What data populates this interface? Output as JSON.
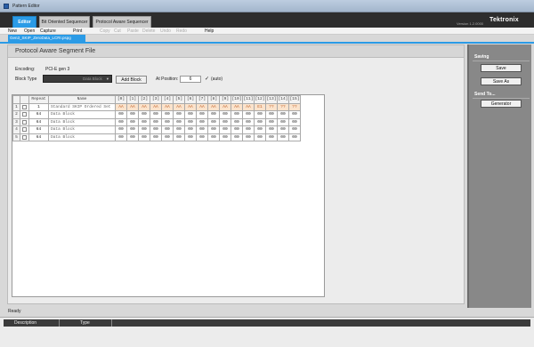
{
  "window": {
    "title": "Pattern Editor"
  },
  "tabs": [
    {
      "label": "Editor",
      "active": true
    },
    {
      "label": "Bit Oriented Sequencer",
      "active": false
    },
    {
      "label": "Protocol Aware Sequencer",
      "active": false
    }
  ],
  "version": "Version 1.2.0000",
  "logo": "Tektronix",
  "menus": {
    "file": [
      "New",
      "Open",
      "Capture",
      "Print"
    ],
    "edit": [
      "Copy",
      "Cut",
      "Paste",
      "Delete",
      "Undo",
      "Redo"
    ],
    "help": "Help"
  },
  "file_tab": "Gen3_SKIP_ZeroData_LCRI.pspg",
  "editor": {
    "title": "Protocol Aware Segment File",
    "encoding_label": "Encoding:",
    "encoding_value": "PCI-E gen 3",
    "block_type_label": "Block Type",
    "block_type_value": "Data Block",
    "add_block": "Add Block",
    "at_position_label": "At Position:",
    "position_value": "6",
    "auto_label": "(auto)"
  },
  "table": {
    "headers": [
      "",
      "",
      "Repeat",
      "Name",
      "[0]",
      "[1]",
      "[2]",
      "[3]",
      "[4]",
      "[5]",
      "[6]",
      "[7]",
      "[8]",
      "[9]",
      "[10]",
      "[11]",
      "[12]",
      "[13]",
      "[14]",
      "[15]"
    ],
    "rows": [
      {
        "num": "1",
        "repeat": "1",
        "name": "Standard SKIP Ordered Set",
        "bytes": [
          "AA",
          "AA",
          "AA",
          "AA",
          "AA",
          "AA",
          "AA",
          "AA",
          "AA",
          "AA",
          "AA",
          "AA",
          "E1",
          "??",
          "??",
          "??"
        ],
        "hl": true
      },
      {
        "num": "2",
        "repeat": "64",
        "name": "Data Block",
        "bytes": [
          "00",
          "00",
          "00",
          "00",
          "00",
          "00",
          "00",
          "00",
          "00",
          "00",
          "00",
          "00",
          "00",
          "00",
          "00",
          "00"
        ],
        "hl": false
      },
      {
        "num": "3",
        "repeat": "64",
        "name": "Data Block",
        "bytes": [
          "00",
          "00",
          "00",
          "00",
          "00",
          "00",
          "00",
          "00",
          "00",
          "00",
          "00",
          "00",
          "00",
          "00",
          "00",
          "00"
        ],
        "hl": false
      },
      {
        "num": "4",
        "repeat": "64",
        "name": "Data Block",
        "bytes": [
          "00",
          "00",
          "00",
          "00",
          "00",
          "00",
          "00",
          "00",
          "00",
          "00",
          "00",
          "00",
          "00",
          "00",
          "00",
          "00"
        ],
        "hl": false
      },
      {
        "num": "5",
        "repeat": "64",
        "name": "Data Block",
        "bytes": [
          "00",
          "00",
          "00",
          "00",
          "00",
          "00",
          "00",
          "00",
          "00",
          "00",
          "00",
          "00",
          "00",
          "00",
          "00",
          "00"
        ],
        "hl": false
      }
    ]
  },
  "status": "Ready",
  "bottom_columns": [
    "Description",
    "Type"
  ],
  "right_panel": {
    "saving_title": "Saving",
    "save": "Save",
    "save_as": "Save As",
    "send_to_title": "Send To...",
    "generator": "Generator"
  }
}
